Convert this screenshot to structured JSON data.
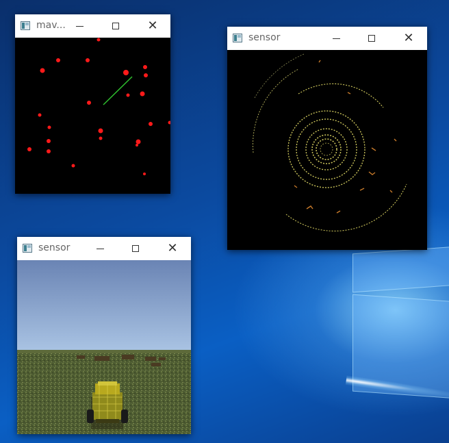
{
  "windows": {
    "map": {
      "title": "mav...",
      "close_glyph": "✕"
    },
    "sensor_lidar": {
      "title": "sensor",
      "close_glyph": "✕"
    },
    "sensor_camera": {
      "title": "sensor",
      "close_glyph": "✕"
    }
  },
  "icons": {
    "app": "opencv-window-icon",
    "minimize": "minimize-icon",
    "maximize": "maximize-icon",
    "close": "close-icon"
  },
  "colors": {
    "obstacle_points": "#ff1a1a",
    "heading_line": "#2fbf2f",
    "lidar_rings": "#c9c25a",
    "lidar_returns": "#c87a2a",
    "sky_top": "#6a84b4",
    "sky_horizon": "#a9c3e3",
    "grass": "#4c5a30"
  }
}
